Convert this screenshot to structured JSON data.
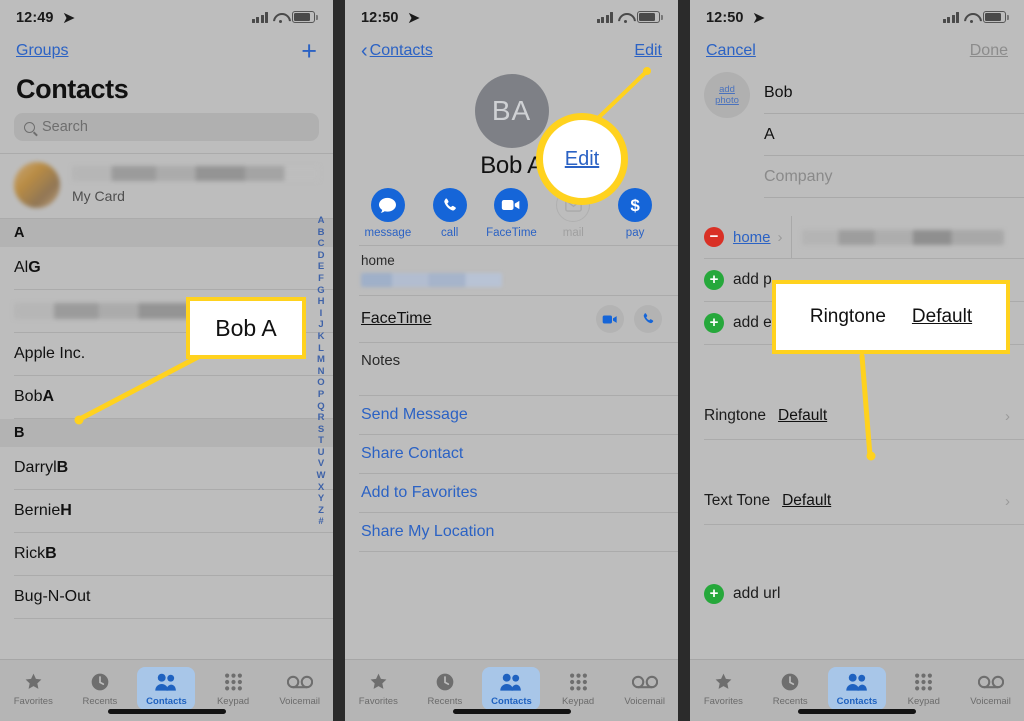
{
  "panel1": {
    "status": {
      "time": "12:49",
      "location_icon": "location-arrow-icon"
    },
    "nav": {
      "left_label": "Groups",
      "add_label": "+"
    },
    "title": "Contacts",
    "search": {
      "placeholder": "Search",
      "icon": "search-icon"
    },
    "my_card": {
      "label": "My Card",
      "name_redacted": true
    },
    "list": [
      {
        "type": "section",
        "label": "A"
      },
      {
        "type": "contact",
        "first": "Al",
        "last": "G"
      },
      {
        "type": "redacted"
      },
      {
        "type": "contact",
        "first": "Apple Inc.",
        "last": ""
      },
      {
        "type": "contact",
        "first": "Bob",
        "last": "A"
      },
      {
        "type": "section",
        "label": "B"
      },
      {
        "type": "contact",
        "first": "Darryl",
        "last": "B"
      },
      {
        "type": "contact",
        "first": "Bernie",
        "last": "H"
      },
      {
        "type": "contact",
        "first": "Rick",
        "last": "B"
      },
      {
        "type": "contact",
        "first": "Bug-N-Out",
        "last": ""
      }
    ],
    "alpha_index": [
      "A",
      "B",
      "C",
      "D",
      "E",
      "F",
      "G",
      "H",
      "I",
      "J",
      "K",
      "L",
      "M",
      "N",
      "O",
      "P",
      "Q",
      "R",
      "S",
      "T",
      "U",
      "V",
      "W",
      "X",
      "Y",
      "Z",
      "#"
    ]
  },
  "panel2": {
    "status": {
      "time": "12:50"
    },
    "nav": {
      "back_label": "Contacts",
      "edit_label": "Edit"
    },
    "avatar_initials": "BA",
    "contact_name": "Bob A",
    "actions": [
      {
        "label": "message",
        "icon": "message-bubble-icon",
        "enabled": true
      },
      {
        "label": "call",
        "icon": "phone-icon",
        "enabled": true
      },
      {
        "label": "FaceTime",
        "icon": "video-camera-icon",
        "enabled": true
      },
      {
        "label": "mail",
        "icon": "envelope-icon",
        "enabled": false
      },
      {
        "label": "pay",
        "icon": "dollar-sign-icon",
        "enabled": true
      }
    ],
    "phone_field_label": "home",
    "facetime_label": "FaceTime",
    "facetime_buttons": [
      "video-camera-icon",
      "phone-icon"
    ],
    "notes_label": "Notes",
    "links": [
      "Send Message",
      "Share Contact",
      "Add to Favorites",
      "Share My Location"
    ]
  },
  "panel3": {
    "status": {
      "time": "12:50"
    },
    "nav": {
      "cancel_label": "Cancel",
      "done_label": "Done"
    },
    "add_photo_line1": "add",
    "add_photo_line2": "photo",
    "first_name": "Bob",
    "last_name": "A",
    "company_placeholder": "Company",
    "phone_row": {
      "label": "home",
      "remove_icon": "minus-circle-icon",
      "value_redacted": true
    },
    "add_phone_label": "add p",
    "add_email_label": "add email",
    "ringtone": {
      "label": "Ringtone",
      "value": "Default"
    },
    "texttone": {
      "label": "Text Tone",
      "value": "Default"
    },
    "add_url_label": "add url"
  },
  "tabbar": {
    "items": [
      {
        "label": "Favorites",
        "icon": "star-icon",
        "active": false
      },
      {
        "label": "Recents",
        "icon": "clock-icon",
        "active": false
      },
      {
        "label": "Contacts",
        "icon": "people-icon",
        "active": true
      },
      {
        "label": "Keypad",
        "icon": "grid-dots-icon",
        "active": false
      },
      {
        "label": "Voicemail",
        "icon": "voicemail-icon",
        "active": false
      }
    ]
  },
  "callouts": {
    "bob": "Bob A",
    "edit": "Edit",
    "ringtone_label": "Ringtone",
    "ringtone_value": "Default"
  },
  "colors": {
    "accent_blue": "#2b62c4",
    "callout_yellow": "#ffd21e",
    "panel_bg": "#bdbdbd",
    "green": "#26a83b",
    "red": "#d93025"
  }
}
